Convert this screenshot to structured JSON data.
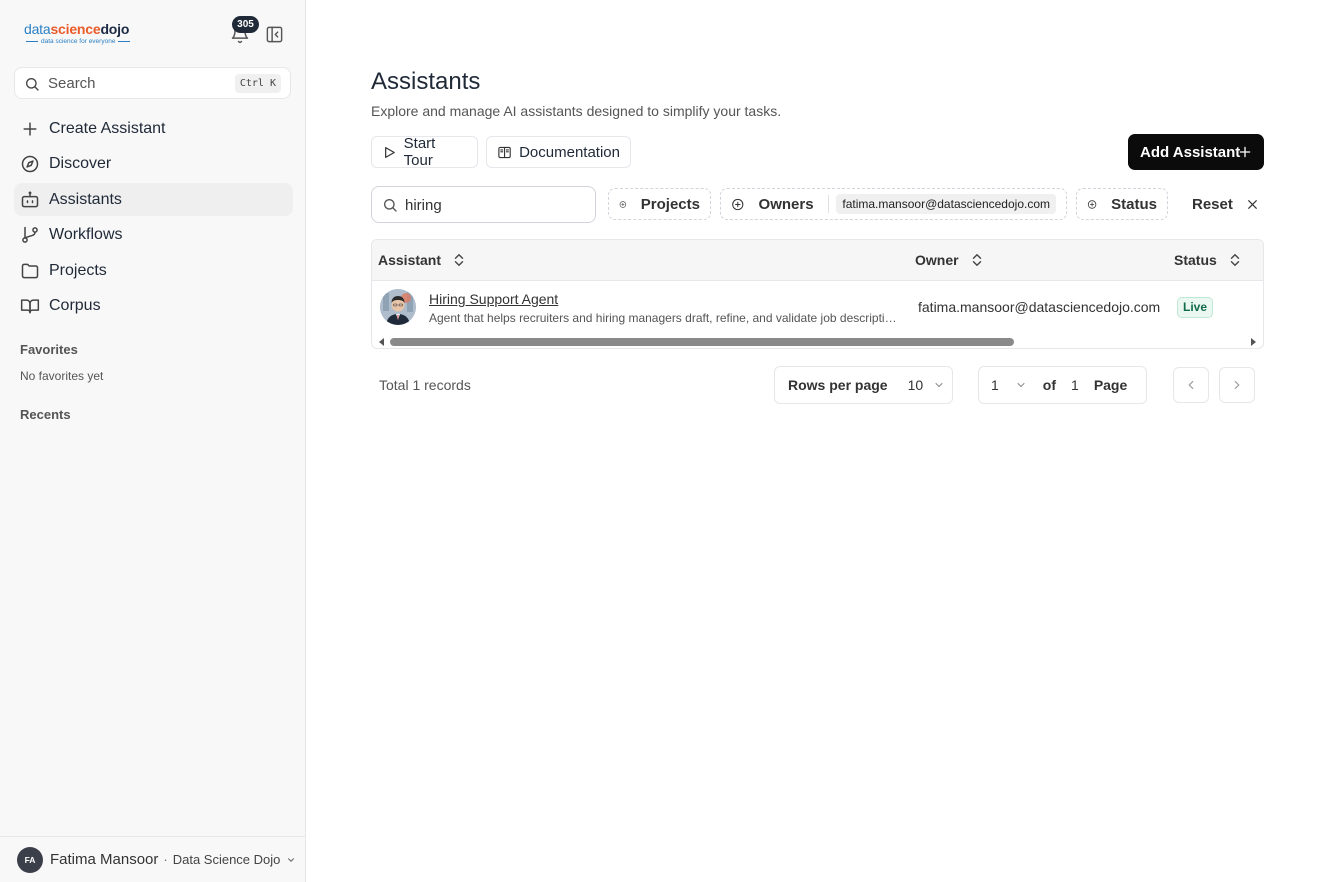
{
  "sidebar": {
    "logo": {
      "part1": "data",
      "part2": "sci",
      "part3": "ence",
      "part4": "dojo",
      "tagline": "data science for everyone"
    },
    "notifications_count": "305",
    "search": {
      "placeholder": "Search",
      "shortcut": "Ctrl K"
    },
    "nav": [
      {
        "label": "Create Assistant",
        "icon": "plus-icon"
      },
      {
        "label": "Discover",
        "icon": "compass-icon"
      },
      {
        "label": "Assistants",
        "icon": "bot-icon",
        "active": true
      },
      {
        "label": "Workflows",
        "icon": "git-branch-icon"
      },
      {
        "label": "Projects",
        "icon": "folder-icon"
      },
      {
        "label": "Corpus",
        "icon": "book-icon"
      }
    ],
    "favorites_title": "Favorites",
    "favorites_empty": "No favorites yet",
    "recents_title": "Recents",
    "user": {
      "initials": "FA",
      "name": "Fatima Mansoor",
      "separator": "·",
      "org": "Data Science Dojo"
    }
  },
  "main": {
    "title": "Assistants",
    "subtitle": "Explore and manage AI assistants designed to simplify your tasks.",
    "start_tour": "Start Tour",
    "documentation": "Documentation",
    "add_assistant": "Add Assistant",
    "filters": {
      "search_value": "hiring",
      "projects": "Projects",
      "owners": "Owners",
      "owner_tag": "fatima.mansoor@datasciencedojo.com",
      "status": "Status",
      "reset": "Reset"
    },
    "table": {
      "columns": [
        "Assistant",
        "Owner",
        "Status"
      ],
      "rows": [
        {
          "name": "Hiring Support Agent",
          "description": "Agent that helps recruiters and hiring managers draft, refine, and validate job descriptions for accuracy, clarity, and inclusivity.",
          "owner": "fatima.mansoor@datasciencedojo.com",
          "status": "Live"
        }
      ]
    },
    "pagination": {
      "total": "Total 1 records",
      "rows_per_page_label": "Rows per page",
      "rows_per_page": "10",
      "current_page": "1",
      "of": "of",
      "total_pages": "1",
      "page_label": "Page"
    }
  },
  "colors": {
    "primary_button": "#0b0b0b",
    "status_live": "#126b4a",
    "logo_blue": "#2a7fc4",
    "logo_orange": "#ea5b2a"
  }
}
